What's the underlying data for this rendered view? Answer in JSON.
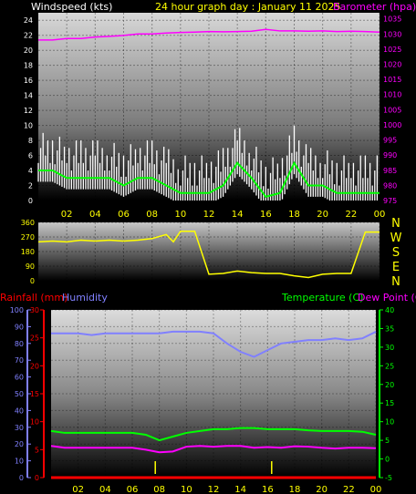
{
  "header": {
    "windspeed_label": "Windspeed (kts)",
    "title": "24 hour graph day :  January 11 2025",
    "barometer_label": "Barometer (hpa)"
  },
  "middle": {
    "compass_letters": [
      "N",
      "W",
      "S",
      "E",
      "N"
    ]
  },
  "bottom_header": {
    "rainfall_label": "Rainfall (mm)",
    "humidity_label": "Humidity",
    "temperature_label": "Temperature (C)",
    "dewpoint_label": "Dew Point (C)"
  },
  "colors": {
    "windspeed": "#ffffff",
    "windspeed_avg": "#00ff00",
    "barometer": "#ff00ff",
    "direction": "#ffff00",
    "rainfall": "#ff0000",
    "humidity": "#8080ff",
    "temperature": "#00ff00",
    "dewpoint": "#ff00ff",
    "tick_text_x": "#ffff00"
  },
  "chart_data": [
    {
      "type": "line",
      "title": "24 hour graph day :  January 11 2025",
      "x_tick_labels": [
        "02",
        "04",
        "06",
        "08",
        "10",
        "12",
        "14",
        "16",
        "18",
        "20",
        "22",
        "00"
      ],
      "xlim_hours": [
        0,
        24
      ],
      "left_axis": {
        "label": "Windspeed (kts)",
        "ylim": [
          0,
          25
        ],
        "ticks": [
          0,
          2,
          4,
          6,
          8,
          10,
          12,
          14,
          16,
          18,
          20,
          22,
          24
        ]
      },
      "right_axis": {
        "label": "Barometer (hpa)",
        "ylim": [
          975,
          1037
        ],
        "ticks": [
          975,
          980,
          985,
          990,
          995,
          1000,
          1005,
          1010,
          1015,
          1020,
          1025,
          1030,
          1035
        ]
      },
      "series": [
        {
          "name": "Windspeed (kts)",
          "axis": "left",
          "x": [
            0,
            1,
            2,
            3,
            4,
            5,
            6,
            7,
            8,
            9,
            10,
            11,
            12,
            13,
            14,
            15,
            16,
            17,
            18,
            19,
            20,
            21,
            22,
            23,
            24
          ],
          "values": [
            4,
            4,
            3,
            3,
            3,
            3,
            2,
            3,
            3,
            2,
            1,
            1,
            1,
            2,
            5,
            3,
            0.5,
            1,
            5,
            2,
            2,
            1,
            1,
            1,
            1
          ]
        },
        {
          "name": "Barometer (hpa)",
          "axis": "right",
          "x": [
            0,
            1,
            2,
            3,
            4,
            5,
            6,
            7,
            8,
            9,
            10,
            11,
            12,
            13,
            14,
            15,
            16,
            17,
            18,
            19,
            20,
            21,
            22,
            23,
            24
          ],
          "values": [
            1028,
            1028,
            1028.5,
            1028.5,
            1029,
            1029.2,
            1029.5,
            1030,
            1030,
            1030.3,
            1030.5,
            1030.6,
            1030.8,
            1030.7,
            1030.8,
            1030.9,
            1031.5,
            1031,
            1031,
            1030.9,
            1031,
            1030.8,
            1030.9,
            1030.8,
            1030.6
          ]
        }
      ]
    },
    {
      "type": "line",
      "ylim": [
        0,
        360
      ],
      "y_ticks": [
        0,
        90,
        180,
        270,
        360
      ],
      "compass_letters": [
        "N",
        "W",
        "S",
        "E",
        "N"
      ],
      "series": [
        {
          "x": [
            0,
            1,
            2,
            3,
            4,
            5,
            6,
            7,
            8,
            9,
            9.5,
            10,
            11,
            12,
            13,
            14,
            15,
            16,
            17,
            18,
            19,
            20,
            21,
            22,
            23,
            24
          ],
          "values": [
            240,
            245,
            240,
            250,
            245,
            250,
            245,
            250,
            260,
            285,
            240,
            305,
            305,
            40,
            45,
            60,
            50,
            45,
            45,
            30,
            20,
            40,
            45,
            45,
            300,
            300
          ]
        }
      ]
    },
    {
      "type": "line",
      "x_tick_labels": [
        "02",
        "04",
        "06",
        "08",
        "10",
        "12",
        "14",
        "16",
        "18",
        "20",
        "22",
        "00"
      ],
      "xlim_hours": [
        0,
        24
      ],
      "humidity_axis": {
        "label": "Humidity",
        "ylim": [
          0,
          100
        ],
        "ticks": [
          0,
          10,
          20,
          30,
          40,
          50,
          60,
          70,
          80,
          90,
          100
        ]
      },
      "rainfall_axis": {
        "label": "Rainfall (mm)",
        "ylim": [
          0,
          30
        ],
        "ticks": [
          0,
          5,
          10,
          15,
          20,
          25,
          30
        ]
      },
      "temperature_axis": {
        "label": "Temperature (C)",
        "ylim": [
          -5,
          40
        ],
        "ticks": [
          -5,
          0,
          5,
          10,
          15,
          20,
          25,
          30,
          35,
          40
        ]
      },
      "series": [
        {
          "name": "Humidity",
          "axis": "humidity",
          "x": [
            0,
            1,
            2,
            3,
            4,
            5,
            6,
            7,
            8,
            9,
            10,
            11,
            12,
            13,
            14,
            15,
            16,
            17,
            18,
            19,
            20,
            21,
            22,
            23,
            24
          ],
          "values": [
            86,
            86,
            86,
            85,
            86,
            86,
            86,
            86,
            86,
            87,
            87,
            87,
            86,
            80,
            75,
            72,
            76,
            80,
            81,
            82,
            82,
            83,
            82,
            83,
            87
          ]
        },
        {
          "name": "Rainfall (mm)",
          "axis": "rainfall",
          "x": [
            0,
            24
          ],
          "values": [
            0,
            0
          ]
        },
        {
          "name": "Temperature (C)",
          "axis": "temperature",
          "x": [
            0,
            1,
            2,
            3,
            4,
            5,
            6,
            7,
            8,
            9,
            10,
            11,
            12,
            13,
            14,
            15,
            16,
            17,
            18,
            19,
            20,
            21,
            22,
            23,
            24
          ],
          "values": [
            7.5,
            7,
            7,
            7,
            7,
            7,
            7,
            6.5,
            5,
            6,
            7,
            7.5,
            8,
            8,
            8.3,
            8.3,
            8,
            8,
            8,
            7.7,
            7.5,
            7.5,
            7.5,
            7.3,
            6.5
          ]
        },
        {
          "name": "Dew Point (C)",
          "axis": "temperature",
          "x": [
            0,
            1,
            2,
            3,
            4,
            5,
            6,
            7,
            8,
            9,
            10,
            11,
            12,
            13,
            14,
            15,
            16,
            17,
            18,
            19,
            20,
            21,
            22,
            23,
            24
          ],
          "values": [
            3.5,
            3,
            3,
            3,
            3,
            3,
            3,
            2.5,
            1.8,
            2,
            3.3,
            3.5,
            3.3,
            3.5,
            3.5,
            3,
            3.2,
            3,
            3.4,
            3.3,
            3,
            2.8,
            3,
            3,
            2.9
          ]
        }
      ]
    }
  ]
}
